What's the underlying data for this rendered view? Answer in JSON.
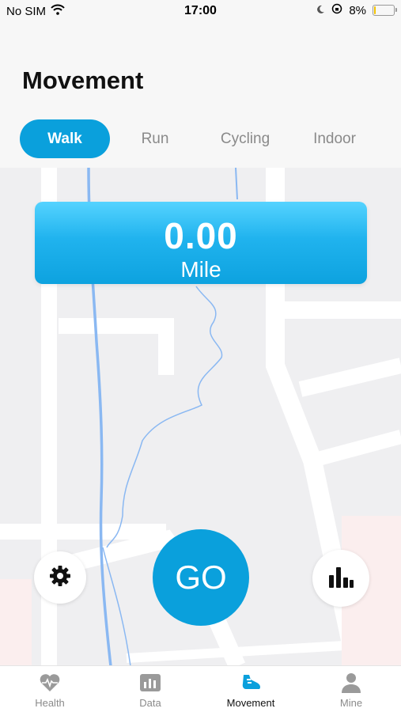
{
  "status_bar": {
    "carrier": "No SIM",
    "time": "17:00",
    "battery_percent": "8%",
    "battery_level": 0.08
  },
  "header": {
    "title": "Movement"
  },
  "tabs": [
    {
      "label": "Walk",
      "active": true
    },
    {
      "label": "Run",
      "active": false
    },
    {
      "label": "Cycling",
      "active": false
    },
    {
      "label": "Indoor",
      "active": false
    }
  ],
  "distance": {
    "value": "0.00",
    "unit": "Mile"
  },
  "controls": {
    "go_label": "GO",
    "settings_icon": "gear-icon",
    "stats_icon": "bar-chart-icon"
  },
  "bottom_nav": [
    {
      "label": "Health",
      "icon": "heart-pulse-icon",
      "active": false
    },
    {
      "label": "Data",
      "icon": "bar-chart-icon",
      "active": false
    },
    {
      "label": "Movement",
      "icon": "shoe-icon",
      "active": true
    },
    {
      "label": "Mine",
      "icon": "user-icon",
      "active": false
    }
  ],
  "colors": {
    "accent": "#0aa0dc",
    "inactive_text": "#8a8a8a",
    "battery": "#f2c200"
  }
}
